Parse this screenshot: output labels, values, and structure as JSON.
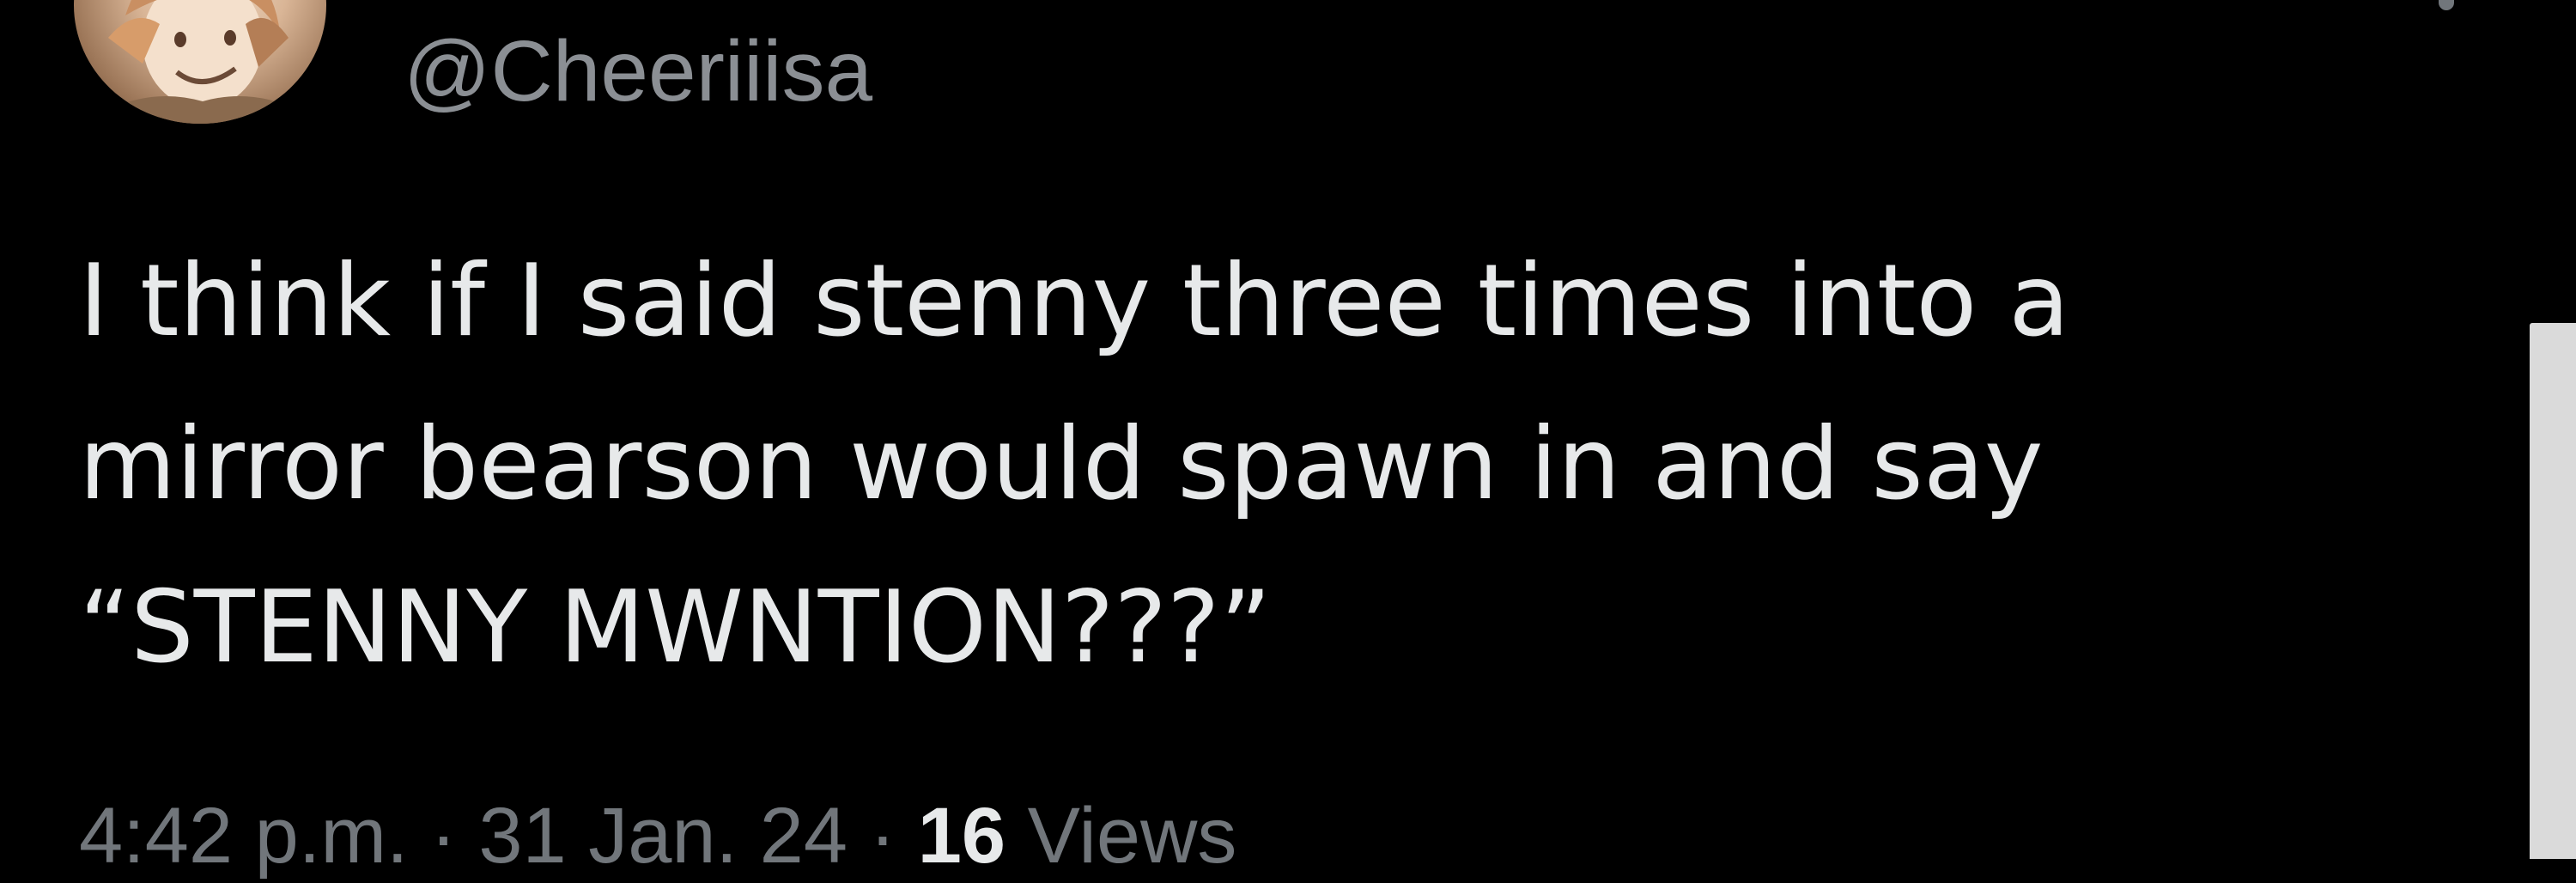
{
  "profile": {
    "handle": "@Cheeriiisa"
  },
  "tweet": {
    "lines": [
      "I think if I said stenny three times into a",
      "mirror bearson would spawn in and say",
      "“STENNY MWNTION???”"
    ]
  },
  "meta": {
    "time": "4:42 p.m.",
    "separator_1": "·",
    "date": "31 Jan. 24",
    "separator_2": "·",
    "views_count": "16",
    "views_label": "Views"
  },
  "icons": {
    "avatar": "profile-avatar",
    "menu": "more-options-icon"
  },
  "colors": {
    "background": "#000000",
    "primary_text": "#e7e9ea",
    "secondary_text": "#71767b",
    "scrollbar": "#dadada"
  }
}
